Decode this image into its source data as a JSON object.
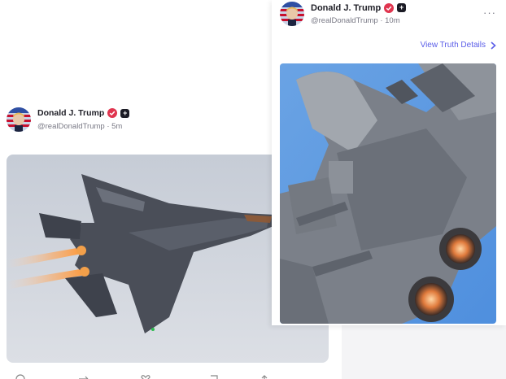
{
  "left_post": {
    "author_name": "Donald J. Trump",
    "handle": "@realDonaldTrump",
    "time": "5m",
    "image_alt": "F-22 Raptor in flight with afterburners"
  },
  "right_post": {
    "author_name": "Donald J. Trump",
    "handle": "@realDonaldTrump",
    "time": "10m",
    "more_label": "···",
    "view_details_label": "View Truth Details",
    "image_alt": "Underside of fighter jet with afterburners"
  },
  "badges": {
    "plus": "+"
  },
  "colors": {
    "accent": "#5b5ee8",
    "verified": "#e0354f",
    "text_dark": "#1e1e26",
    "text_muted": "#7a7a86"
  },
  "icons": [
    "verified-badge-icon",
    "plus-badge-icon",
    "more-icon",
    "chevron-right-icon",
    "reply-icon",
    "retruth-icon",
    "like-icon",
    "bookmark-icon",
    "share-icon"
  ]
}
